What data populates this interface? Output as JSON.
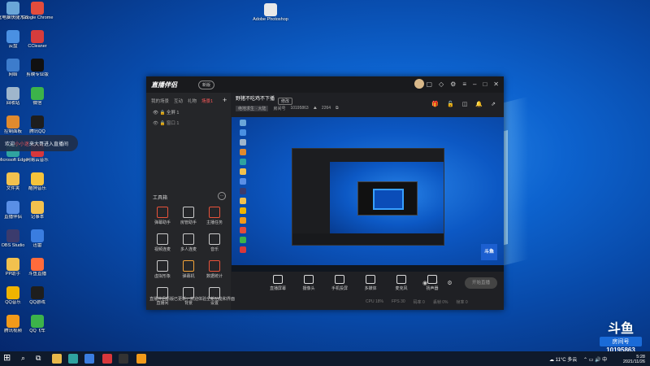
{
  "desktop": {
    "icons_col1": [
      {
        "label": "此电脑快捷方式",
        "color": "#6aa6d8"
      },
      {
        "label": "云盘",
        "color": "#4a90e2"
      },
      {
        "label": "网络",
        "color": "#3d7ccc"
      },
      {
        "label": "回收站",
        "color": "#9fb6cc"
      },
      {
        "label": "控制面板",
        "color": "#e08a2e"
      },
      {
        "label": "Microsoft Edge",
        "color": "#2fa3a0"
      },
      {
        "label": "文件夹",
        "color": "#f2c14e"
      },
      {
        "label": "直播伴侣",
        "color": "#5a8fe6"
      },
      {
        "label": "OBS Studio",
        "color": "#3b3b6d"
      },
      {
        "label": "PP助手",
        "color": "#f2c14e"
      },
      {
        "label": "QQ音乐",
        "color": "#f0b400"
      },
      {
        "label": "腾讯视频",
        "color": "#f29a1a"
      }
    ],
    "icons_col2": [
      {
        "label": "Google Chrome",
        "color": "#e34c3c"
      },
      {
        "label": "CCleaner",
        "color": "#d63c3c"
      },
      {
        "label": "剪映专业版",
        "color": "#111111"
      },
      {
        "label": "微信",
        "color": "#3cb34a"
      },
      {
        "label": "腾讯QQ",
        "color": "#1e1e1e"
      },
      {
        "label": "网易云音乐",
        "color": "#d8373b"
      },
      {
        "label": "酷狗音乐",
        "color": "#f5c33b"
      },
      {
        "label": "记事本",
        "color": "#f2c14e"
      },
      {
        "label": "迅雷",
        "color": "#3a7de0"
      },
      {
        "label": "斗鱼直播",
        "color": "#ff6b3b"
      },
      {
        "label": "QQ游戏",
        "color": "#1e1e1e"
      },
      {
        "label": "QQ飞车",
        "color": "#3cb34a"
      }
    ],
    "file_icon": {
      "label": "Adobe Photoshop",
      "color": "#e8e8e8"
    },
    "banner": {
      "prefix": "欢迎",
      "highlight": "小小迷",
      "suffix": "来大哥进入直播间"
    }
  },
  "app": {
    "logo": "直播伴侣",
    "badge": "新版",
    "tabs": [
      "我的场景",
      "互动",
      "礼物",
      "场景1"
    ],
    "scene_label": "全屏 1",
    "source_label": "窗口 1",
    "tools_title": "工具箱",
    "tools": [
      {
        "label": "弹幕助手",
        "color": "#e8523a"
      },
      {
        "label": "房管助手",
        "color": "#cccccc"
      },
      {
        "label": "主播任务",
        "color": "#e8523a"
      },
      {
        "label": "视频连麦",
        "color": "#cccccc"
      },
      {
        "label": "多人连麦",
        "color": "#cccccc"
      },
      {
        "label": "音乐",
        "color": "#cccccc"
      },
      {
        "label": "虚拟形象",
        "color": "#cccccc"
      },
      {
        "label": "弹幕机",
        "color": "#f2a33a"
      },
      {
        "label": "数据统计",
        "color": "#e8523a"
      },
      {
        "label": "直播间",
        "color": "#cccccc"
      },
      {
        "label": "背景",
        "color": "#cccccc"
      },
      {
        "label": "设置",
        "color": "#cccccc"
      }
    ],
    "notice": "直播伴侣新版已更新，欢迎体验全新功能和界面",
    "stream_title": "野猪不吃鸡不下播",
    "edit_label": "修改",
    "category": "绝地求生 · 大陆",
    "room_label": "房间号",
    "room_id": "10195863",
    "viewers": "2264",
    "controls": [
      {
        "label": "直播屏幕"
      },
      {
        "label": "摄像头"
      },
      {
        "label": "手机投屏"
      },
      {
        "label": "多媒体"
      },
      {
        "label": "麦克风"
      },
      {
        "label": "扬声器"
      }
    ],
    "start_label": "开始直播",
    "status": [
      "CPU 18%",
      "FPS 30",
      "码率 0",
      "丢帧 0%",
      "帧率 0"
    ],
    "preview_watermark": "斗鱼"
  },
  "watermark": {
    "logo": "斗鱼",
    "room_label": "房间号",
    "room_id": "10195863"
  },
  "taskbar": {
    "weather": "11°C 多云",
    "time": "5:28",
    "date": "2021/11/26"
  }
}
